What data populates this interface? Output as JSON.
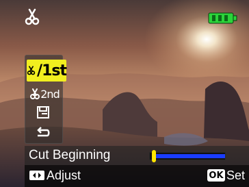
{
  "app": {
    "screen": "movie-edit-cut"
  },
  "toolbar": {
    "left_icon": "scissors-icon",
    "right_icon": "battery-full-icon"
  },
  "menu": {
    "items": [
      {
        "label": "/1st",
        "icon": "scissors-icon",
        "selected": true
      },
      {
        "label": "2nd",
        "icon": "scissors-icon",
        "selected": false
      },
      {
        "label": "",
        "icon": "save-icon",
        "selected": false
      },
      {
        "label": "",
        "icon": "return-icon",
        "selected": false
      }
    ]
  },
  "status": {
    "label": "Cut Beginning",
    "progress_fraction": 0.03
  },
  "footer": {
    "adjust_label": "Adjust",
    "ok_badge": "OK",
    "set_label": "Set"
  },
  "colors": {
    "accent_yellow": "#f1ee1f",
    "battery_green": "#2bd43a",
    "progress_blue": "#1a3cff"
  }
}
